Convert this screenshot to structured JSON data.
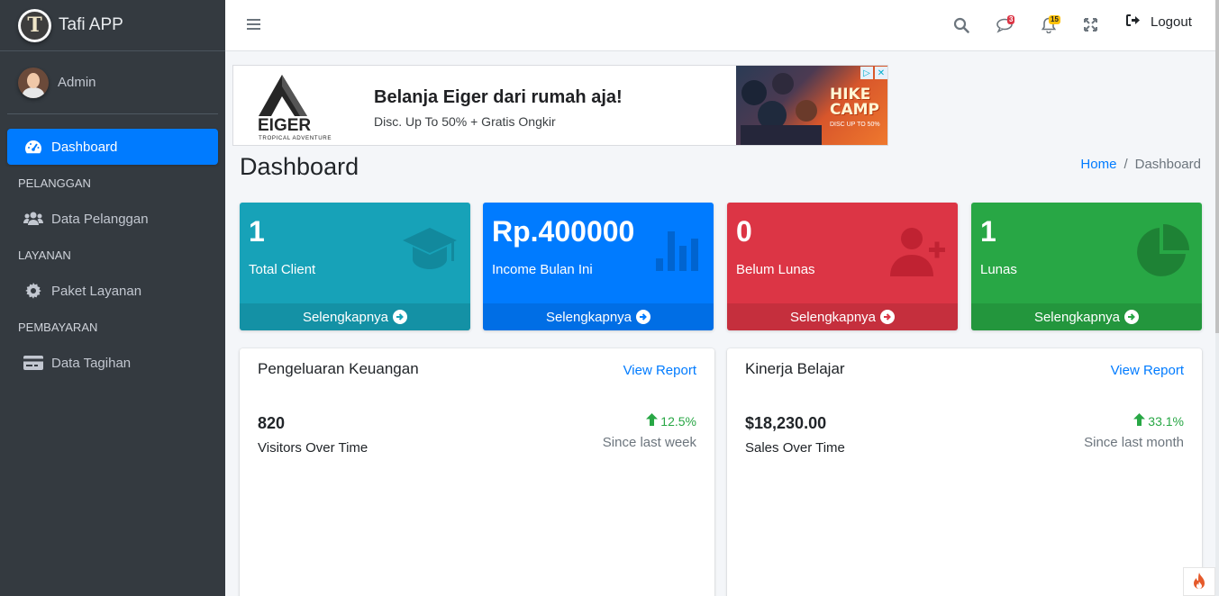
{
  "brand": {
    "name": "Tafi APP",
    "logo_letter": "T"
  },
  "user": {
    "name": "Admin"
  },
  "sidebar": {
    "items": [
      {
        "type": "item",
        "label": "Dashboard",
        "icon": "tachometer-icon",
        "active": true
      },
      {
        "type": "header",
        "label": "PELANGGAN"
      },
      {
        "type": "item",
        "label": "Data Pelanggan",
        "icon": "users-icon"
      },
      {
        "type": "header",
        "label": "LAYANAN"
      },
      {
        "type": "item",
        "label": "Paket Layanan",
        "icon": "gear-icon"
      },
      {
        "type": "header",
        "label": "PEMBAYARAN"
      },
      {
        "type": "item",
        "label": "Data Tagihan",
        "icon": "card-icon"
      }
    ]
  },
  "topbar": {
    "messages_count": "3",
    "notifications_count": "15",
    "logout_label": "Logout"
  },
  "ad": {
    "brand": "EIGER",
    "brand_sub": "TROPICAL ADVENTURE",
    "title": "Belanja Eiger dari rumah aja!",
    "subtitle": "Disc. Up To 50% + Gratis Ongkir",
    "image_text_1": "HIKE",
    "image_text_2": "CAMP",
    "image_text_3": "DISC UP TO 50%"
  },
  "header": {
    "title": "Dashboard",
    "breadcrumb": [
      "Home",
      "/",
      "Dashboard"
    ]
  },
  "stats": [
    {
      "value": "1",
      "label": "Total Client",
      "more": "Selengkapnya",
      "color": "#17a2b8",
      "icon": "graduation-cap-icon"
    },
    {
      "value": "Rp.400000",
      "label": "Income Bulan Ini",
      "more": "Selengkapnya",
      "color": "#007bff",
      "icon": "bar-chart-icon"
    },
    {
      "value": "0",
      "label": "Belum Lunas",
      "more": "Selengkapnya",
      "color": "#dc3545",
      "icon": "user-plus-icon"
    },
    {
      "value": "1",
      "label": "Lunas",
      "more": "Selengkapnya",
      "color": "#28a745",
      "icon": "pie-chart-icon"
    }
  ],
  "cards": [
    {
      "title": "Pengeluaran Keuangan",
      "report": "View Report",
      "value": "820",
      "desc": "Visitors Over Time",
      "pct": "12.5%",
      "since": "Since last week"
    },
    {
      "title": "Kinerja Belajar",
      "report": "View Report",
      "value": "$18,230.00",
      "desc": "Sales Over Time",
      "pct": "33.1%",
      "since": "Since last month"
    }
  ]
}
